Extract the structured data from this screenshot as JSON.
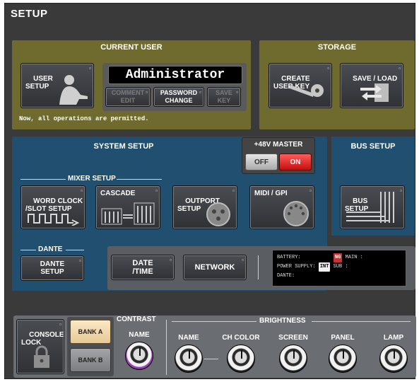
{
  "header": {
    "title": "SETUP"
  },
  "current_user": {
    "title": "CURRENT USER",
    "user_setup": "USER\nSETUP",
    "user_name": "Administrator",
    "comment_edit": "COMMENT\nEDIT",
    "password_change": "PASSWORD\nCHANGE",
    "save_key": "SAVE\nKEY",
    "status": "Now, all operations are permitted."
  },
  "storage": {
    "title": "STORAGE",
    "create_user_key": "CREATE\nUSER KEY",
    "save_load": "SAVE / LOAD"
  },
  "system_setup": {
    "title": "SYSTEM SETUP",
    "master48v": {
      "label": "+48V MASTER",
      "off": "OFF",
      "on": "ON"
    },
    "mixer_setup_label": "MIXER SETUP",
    "word_clock": "WORD CLOCK\n/SLOT SETUP",
    "cascade": "CASCADE",
    "outport": "OUTPORT\nSETUP",
    "midi_gpi": "MIDI / GPI",
    "dante_label": "DANTE",
    "dante_setup": "DANTE\nSETUP",
    "date_time": "DATE\n/TIME",
    "network": "NETWORK",
    "info": {
      "battery_label": "BATTERY:",
      "battery_badge": "NG",
      "main_label": "MAIN :",
      "power_label": "POWER SUPPLY:",
      "power_badge": "INT",
      "sub_label": "SUB  :",
      "dante_label": "DANTE:"
    }
  },
  "bus_setup": {
    "title": "BUS SETUP",
    "button": "BUS\nSETUP"
  },
  "bottom": {
    "console_lock": "CONSOLE\nLOCK",
    "bank_a": "BANK A",
    "bank_b": "BANK B",
    "contrast_title": "CONTRAST",
    "contrast_name": "NAME",
    "brightness_title": "BRIGHTNESS",
    "brightness": [
      "NAME",
      "CH COLOR",
      "SCREEN",
      "PANEL",
      "LAMP"
    ]
  },
  "colors": {
    "olive_panel": "#6f6a2e",
    "blue_panel": "#214f6f",
    "on_red": "#d61f1f",
    "bank_a_active": "#f0d8ab"
  }
}
